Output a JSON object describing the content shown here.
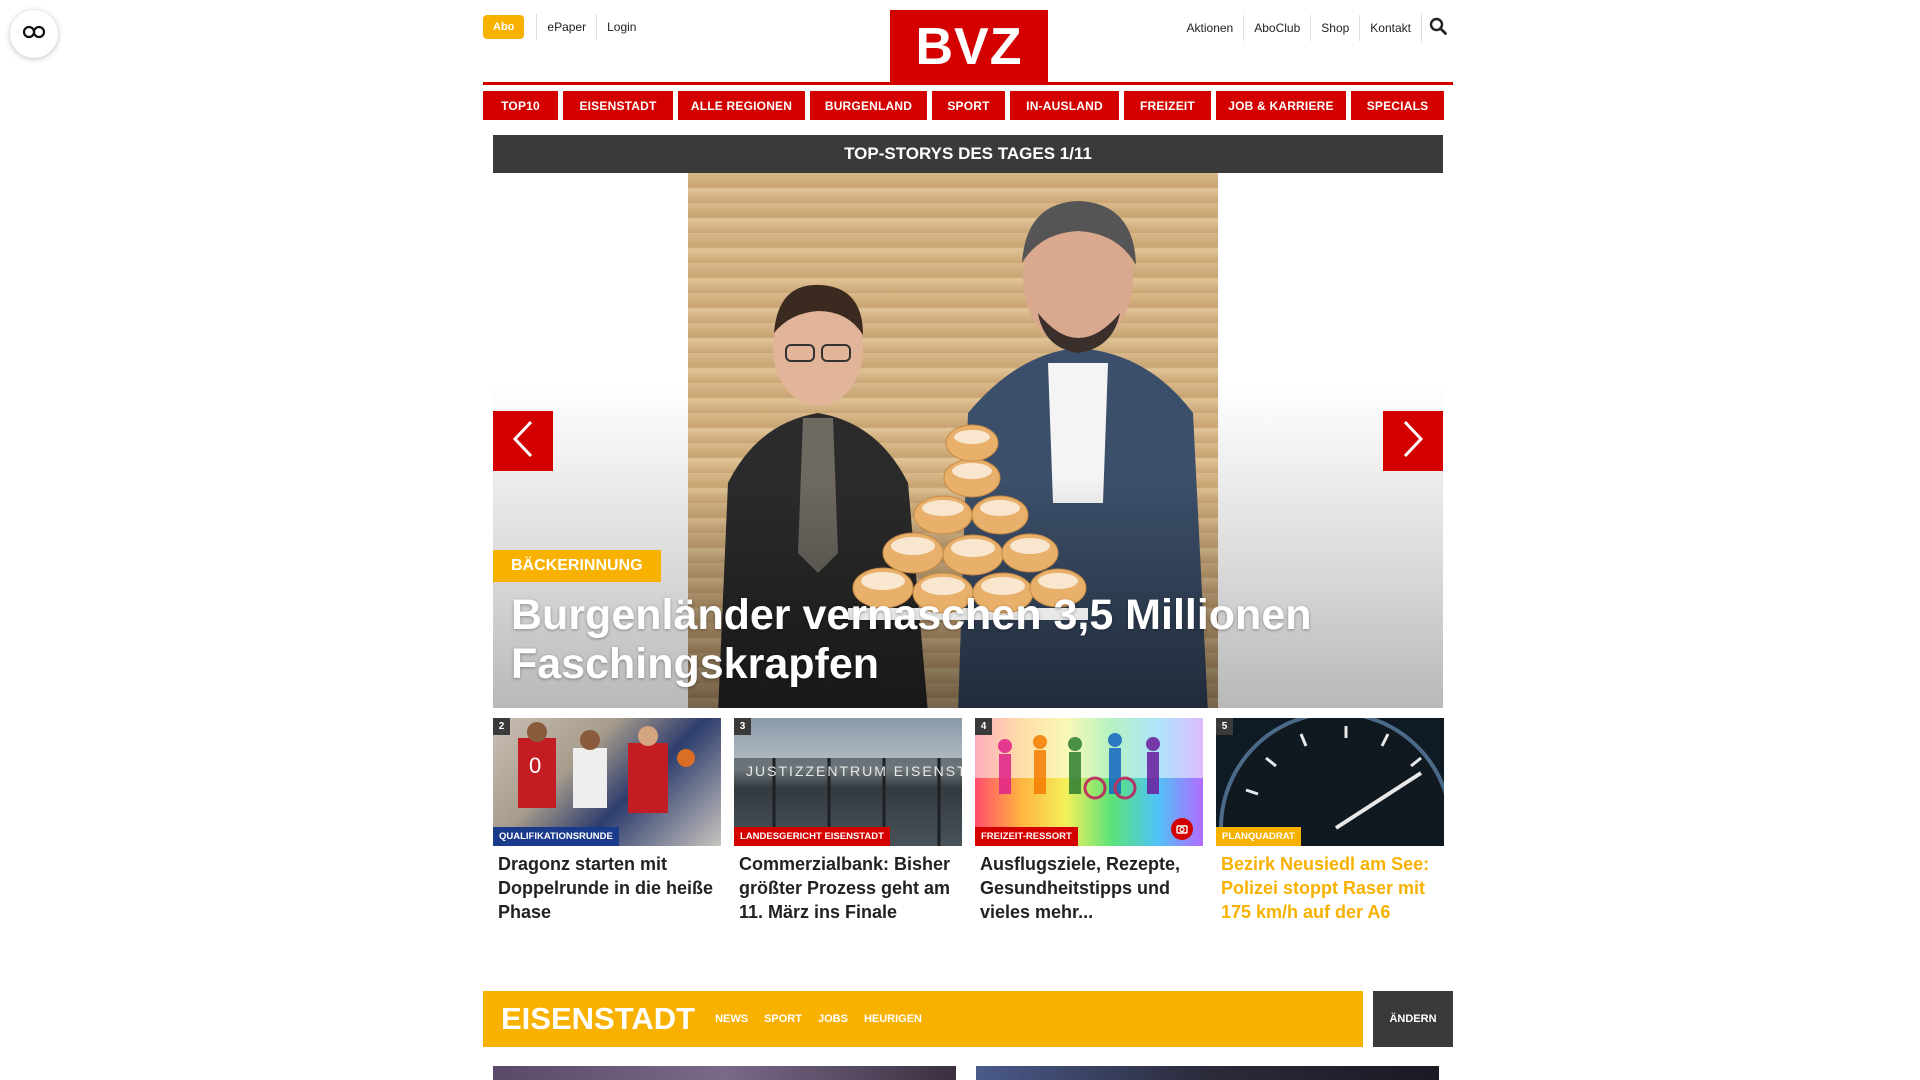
{
  "topbar": {
    "abo_label": "Abo",
    "left_links": [
      "ePaper",
      "Login"
    ],
    "logo_text": "BVZ",
    "right_links": [
      "Aktionen",
      "AboClub",
      "Shop",
      "Kontakt"
    ]
  },
  "nav": {
    "items": [
      {
        "label": "TOP10"
      },
      {
        "label": "EISENSTADT"
      },
      {
        "label": "ALLE REGIONEN"
      },
      {
        "label": "BURGENLAND"
      },
      {
        "label": "SPORT"
      },
      {
        "label": "IN-AUSLAND"
      },
      {
        "label": "FREIZEIT"
      },
      {
        "label": "JOB & KARRIERE"
      },
      {
        "label": "SPECIALS"
      }
    ]
  },
  "slider": {
    "header": "TOP-STORYS DES TAGES 1/11",
    "hero": {
      "tag": "BÄCKERINNUNG",
      "title": "Burgenländer vernaschen 3,5 Millionen Faschingskrapfen"
    }
  },
  "teasers": [
    {
      "num": "2",
      "tag": "QUALIFIKATIONSRUNDE",
      "tag_color": "#1a3a8c",
      "title": "Dragonz starten mit Doppelrunde in die heiße Phase",
      "title_color": "#222222"
    },
    {
      "num": "3",
      "tag": "LANDESGERICHT EISENSTADT",
      "tag_color": "#d40000",
      "title": "Commerzialbank: Bisher größter Prozess geht am 11. März ins Finale",
      "title_color": "#222222"
    },
    {
      "num": "4",
      "tag": "FREIZEIT-RESSORT",
      "tag_color": "#d40000",
      "title": "Ausflugsziele, Rezepte, Gesundheitstipps und vieles mehr...",
      "title_color": "#222222"
    },
    {
      "num": "5",
      "tag": "PLANQUADRAT",
      "tag_color": "#f9b100",
      "title": "Bezirk Neusiedl am See: Polizei stoppt Raser mit 175 km/h auf der A6",
      "title_color": "#f9b100"
    }
  ],
  "region": {
    "title": "EISENSTADT",
    "links": [
      "NEWS",
      "SPORT",
      "JOBS",
      "HEURIGEN"
    ],
    "change_label": "ÄNDERN"
  },
  "colors": {
    "brand_red": "#d40000",
    "accent_yellow": "#f9b100",
    "dark": "#3a3a3a"
  }
}
